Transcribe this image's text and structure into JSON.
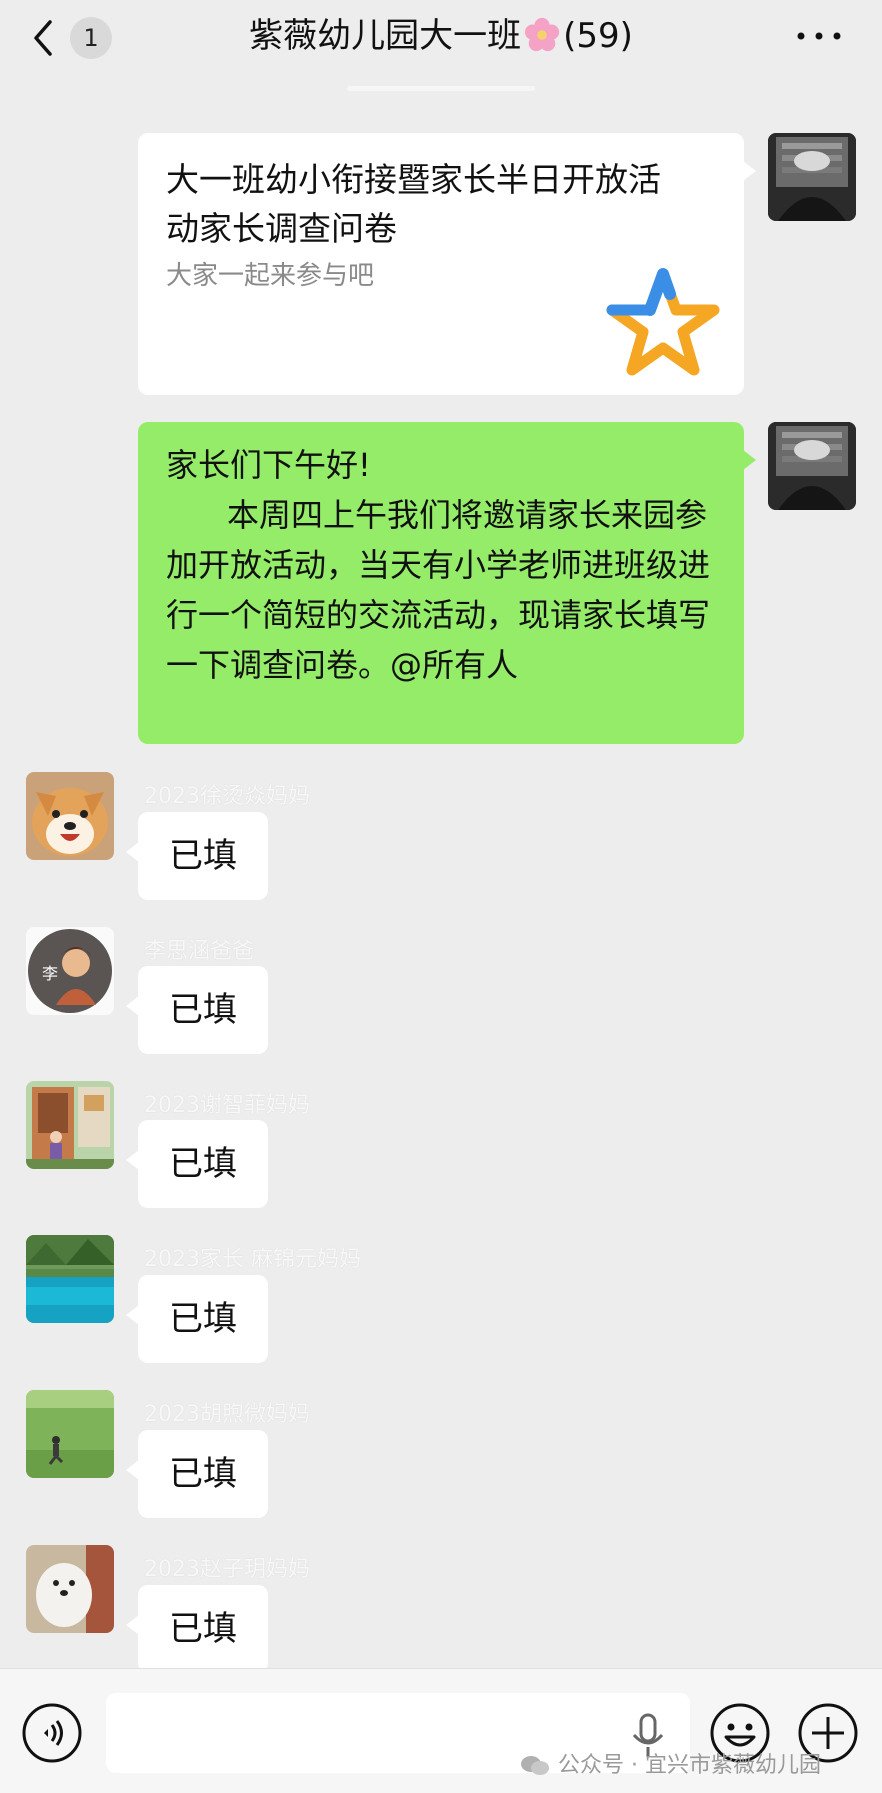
{
  "header": {
    "unread_count": "1",
    "title_prefix": "紫薇幼儿园大一班",
    "title_suffix": "(59)"
  },
  "card": {
    "title": "大一班幼小衔接暨家长半日开放活动家长调查问卷",
    "description": "大家一起来参与吧"
  },
  "announcement": {
    "text": "家长们下午好!\n      本周四上午我们将邀请家长来园参加开放活动，当天有小学老师进班级进行一个简短的交流活动，现请家长填写一下调查问卷。@所有人"
  },
  "messages": [
    {
      "name": "2023徐烫焱妈妈",
      "text": "已填"
    },
    {
      "name": "李思涵爸爸",
      "text": "已填"
    },
    {
      "name": "2023谢智菲妈妈",
      "text": "已填"
    },
    {
      "name": "2023家长 麻锦元妈妈",
      "text": "已填"
    },
    {
      "name": "2023胡煦微妈妈",
      "text": "已填"
    },
    {
      "name": "2023赵子玥妈妈",
      "text": "已填"
    }
  ],
  "avatar_glyphs": {
    "li": "李"
  },
  "watermark": {
    "text": "公众号 · 宜兴市紫薇幼儿园"
  },
  "colors": {
    "background": "#ededed",
    "sent_bubble": "#95ec69",
    "bubble": "#ffffff",
    "star_blue": "#3a8ee6",
    "star_orange": "#f5a623"
  },
  "icons": {
    "back": "chevron-left-icon",
    "more": "ellipsis-icon",
    "voice": "voice-icon",
    "mic": "microphone-icon",
    "emoji": "emoji-icon",
    "plus": "plus-icon",
    "star": "star-icon"
  }
}
